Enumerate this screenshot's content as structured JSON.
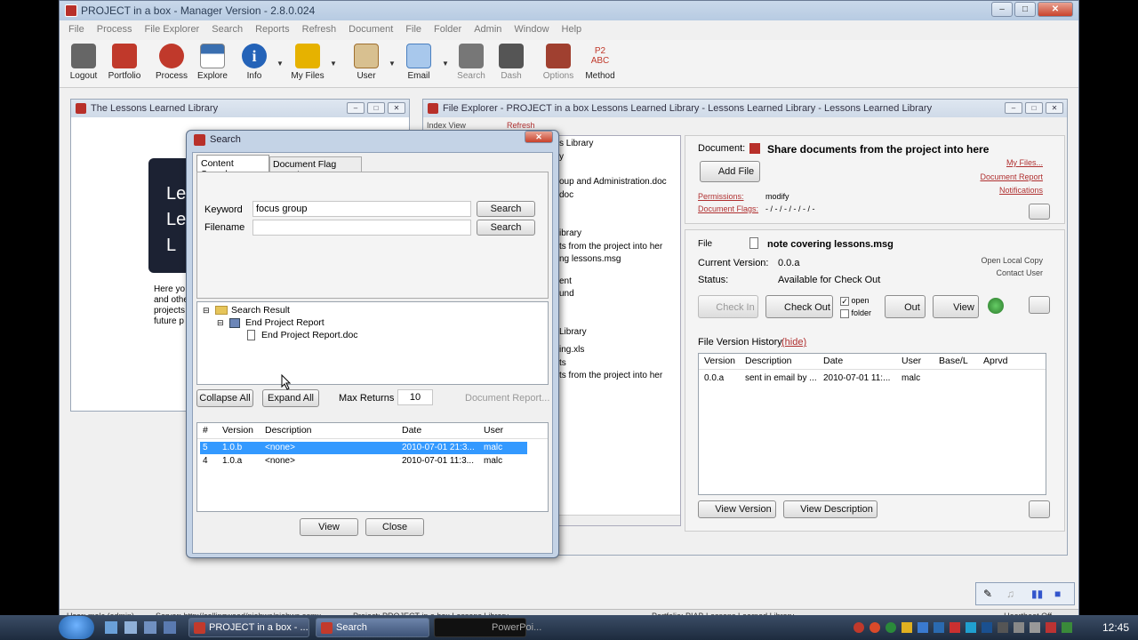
{
  "app": {
    "title": "PROJECT in a box - Manager Version - 2.8.0.024",
    "menu": [
      "File",
      "Process",
      "File Explorer",
      "Search",
      "Reports",
      "Refresh",
      "Document",
      "File",
      "Folder",
      "Admin",
      "Window",
      "Help"
    ],
    "toolbar": [
      {
        "label": "Logout",
        "icon": "logout-icon",
        "color": "#555555"
      },
      {
        "label": "Portfolio",
        "icon": "portfolio-icon",
        "color": "#c0392b"
      },
      {
        "label": "Process",
        "icon": "process-icon",
        "color": "#c0392b"
      },
      {
        "label": "Explore",
        "icon": "explore-icon",
        "color": "#3a6fb0"
      },
      {
        "label": "Info",
        "icon": "info-icon",
        "color": "#2463b8"
      },
      {
        "label": "My Files",
        "icon": "my-files-icon",
        "color": "#e0a800"
      },
      {
        "label": "User",
        "icon": "user-icon",
        "color": "#a07030"
      },
      {
        "label": "Email",
        "icon": "email-icon",
        "color": "#4a80c0"
      },
      {
        "label": "Search",
        "icon": "search-icon",
        "color": "#666666"
      },
      {
        "label": "Dash",
        "icon": "dash-icon",
        "color": "#555555"
      },
      {
        "label": "Options",
        "icon": "options-icon",
        "color": "#a04030"
      },
      {
        "label": "Method",
        "icon": "method-icon",
        "color": "#c0392b",
        "text": "P2\nABC"
      }
    ]
  },
  "lessons_panel": {
    "title": "The Lessons Learned Library",
    "banner_lines": [
      "Le",
      "Le",
      "L"
    ],
    "body_lines": [
      "Here yo",
      "and othe",
      "projects",
      "future p"
    ]
  },
  "explorer": {
    "title": "File Explorer - PROJECT in a box Lessons Learned Library - Lessons Learned Library - Lessons Learned Library",
    "index_view": "Index View",
    "refresh": "Refresh",
    "tree_fragments": [
      "s Library",
      "y",
      "oup and Administration.doc",
      "doc",
      "ibrary",
      "ts from the project into her",
      "ng lessons.msg",
      "ent",
      "und",
      "Library",
      "ing.xls",
      "ts",
      "ts from the project into her"
    ],
    "document_label": "Document:",
    "document_title": "Share documents from the project into here",
    "add_file": "Add File",
    "links": {
      "my_files": "My Files...",
      "doc_report": "Document Report",
      "notifications": "Notifications"
    },
    "permissions_label": "Permissions:",
    "permissions_value": "modify",
    "doc_flags_label": "Document Flags:",
    "doc_flags_value": "- / - / - / - / - / -",
    "file_label": "File",
    "file_name": "note covering lessons.msg",
    "current_version_label": "Current Version:",
    "current_version": "0.0.a",
    "status_label": "Status:",
    "status_value": "Available for Check Out",
    "open_local_copy": "Open Local Copy",
    "contact_user": "Contact User",
    "buttons": {
      "check_in": "Check In",
      "check_out": "Check Out",
      "out": "Out",
      "view": "View",
      "view_version": "View Version",
      "view_description": "View Description"
    },
    "open_check": "open",
    "folder_check": "folder",
    "history_label": "File Version History",
    "hide": "(hide)",
    "history_columns": [
      "Version",
      "Description",
      "Date",
      "User",
      "Base/L",
      "Aprvd"
    ],
    "history_rows": [
      [
        "0.0.a",
        "sent in email by ...",
        "2010-07-01 11:...",
        "malc",
        "",
        ""
      ]
    ]
  },
  "search": {
    "title": "Search",
    "tabs": [
      "Content Search",
      "Document Flag Search"
    ],
    "keyword_label": "Keyword",
    "keyword_value": "focus group",
    "filename_label": "Filename",
    "filename_value": "",
    "search_btn": "Search",
    "tree": {
      "root": "Search Result",
      "child": "End Project Report",
      "leaf": "End Project Report.doc"
    },
    "collapse_all": "Collapse All",
    "expand_all": "Expand All",
    "max_returns_label": "Max Returns",
    "max_returns": "10",
    "doc_report": "Document Report...",
    "columns": [
      "#",
      "Version",
      "Description",
      "Date",
      "User"
    ],
    "rows": [
      [
        "5",
        "1.0.b",
        "<none>",
        "2010-07-01 21:3...",
        "malc"
      ],
      [
        "4",
        "1.0.a",
        "<none>",
        "2010-07-01 11:3...",
        "malc"
      ]
    ],
    "view_btn": "View",
    "close_btn": "Close"
  },
  "statusbar": {
    "user": "User: malc (admin)",
    "server": "Server: http://collingwood/piabws/piabws.asmx",
    "project": "Project: PROJECT in a box Lessons Library",
    "portfolio": "Portfolio: PIAB Lessons Learned Library",
    "heartbeat": "Heartbeat Off"
  },
  "taskbar": {
    "tasks": [
      "PROJECT in a box - ...",
      "Search",
      "PowerPoi..."
    ],
    "clock": "12:45"
  }
}
